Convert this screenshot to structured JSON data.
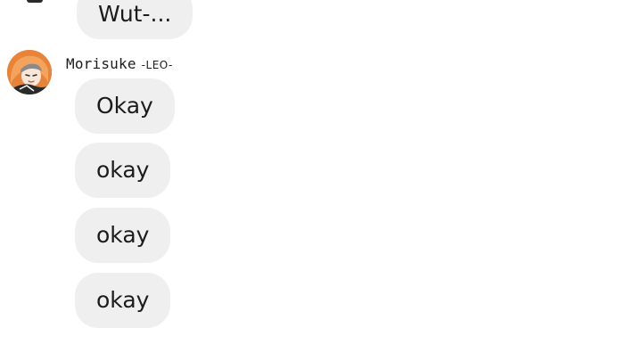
{
  "chat": {
    "previous_message": {
      "text": "Wut-..."
    },
    "group": {
      "sender_name": "Morisuke",
      "sender_tag": "-LEO-",
      "avatar_icon": "anime-character-avatar-icon",
      "messages": [
        {
          "text": "Okay"
        },
        {
          "text": "okay"
        },
        {
          "text": "okay"
        },
        {
          "text": "okay"
        }
      ]
    }
  },
  "colors": {
    "background": "#ffffff",
    "bubble": "#efefef",
    "text": "#1b1b1b",
    "avatar_bg": "#e8843a"
  }
}
